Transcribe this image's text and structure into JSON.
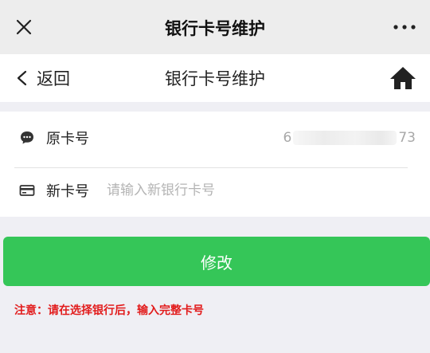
{
  "topbar": {
    "title": "银行卡号维护",
    "close_icon": "close-icon",
    "more_icon": "more-dots-icon"
  },
  "navbar": {
    "back_label": "返回",
    "title": "银行卡号维护",
    "home_icon": "home-icon"
  },
  "form": {
    "old_card": {
      "label": "原卡号",
      "value_prefix": "6",
      "value_suffix": "73",
      "icon": "chat-dots-icon"
    },
    "new_card": {
      "label": "新卡号",
      "placeholder": "请输入新银行卡号",
      "value": "",
      "icon": "credit-card-icon"
    }
  },
  "submit_label": "修改",
  "notice": "注意：请在选择银行后，输入完整卡号",
  "colors": {
    "accent": "#35c658",
    "warning": "#e21c1c"
  }
}
